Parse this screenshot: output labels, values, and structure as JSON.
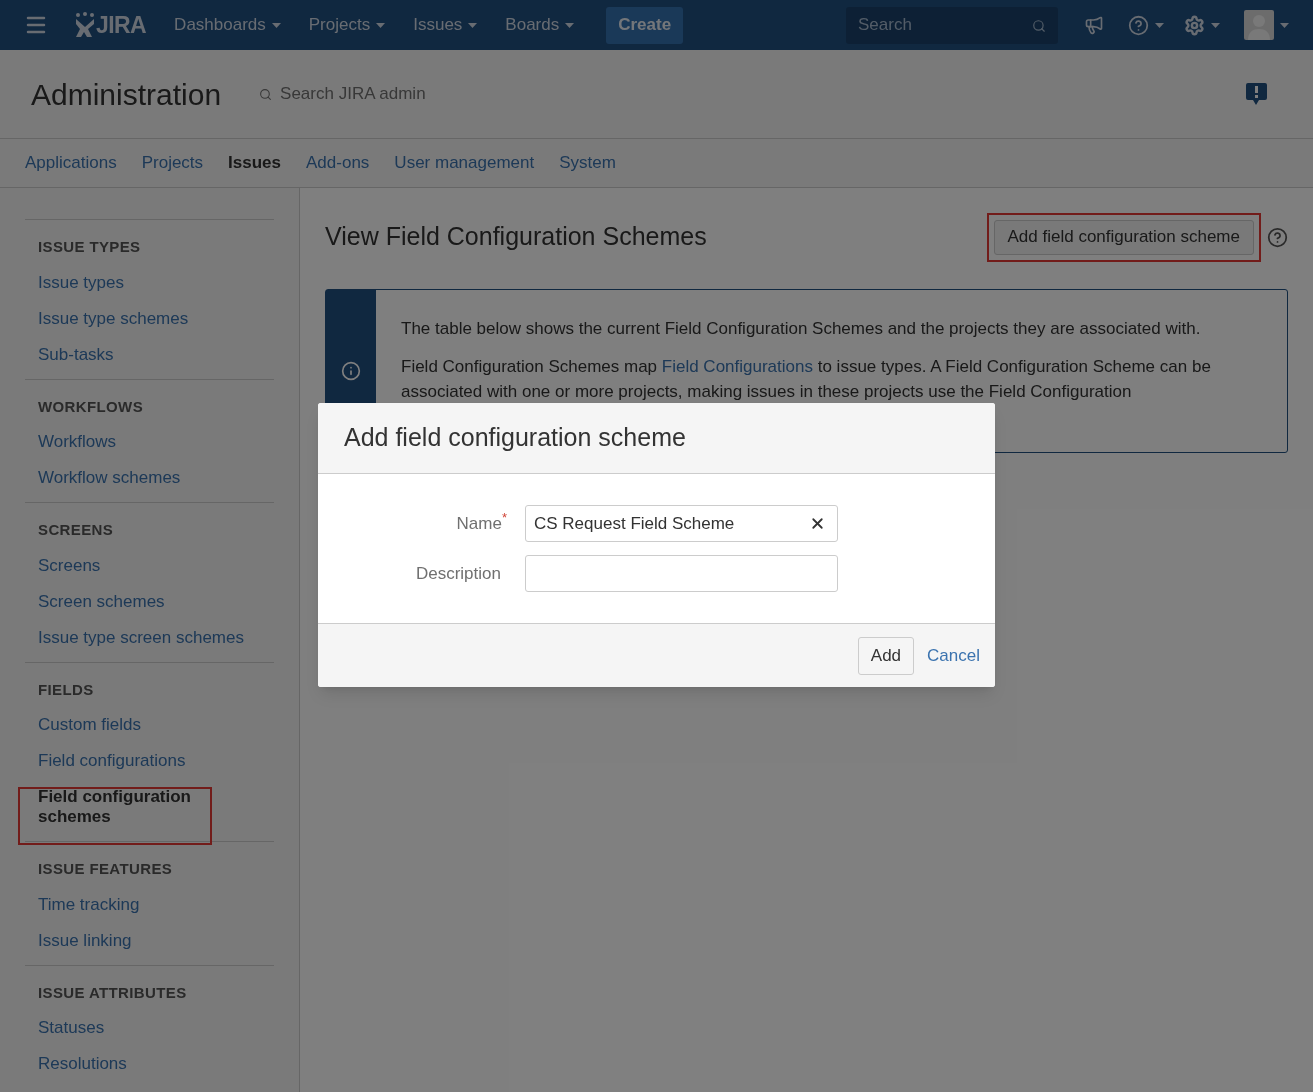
{
  "top_nav": {
    "logo": "JIRA",
    "menus": [
      {
        "label": "Dashboards"
      },
      {
        "label": "Projects"
      },
      {
        "label": "Issues"
      },
      {
        "label": "Boards"
      }
    ],
    "create": "Create",
    "search": {
      "placeholder": "Search"
    }
  },
  "admin": {
    "title": "Administration",
    "search": "Search JIRA admin"
  },
  "tabs": [
    {
      "label": "Applications",
      "selected": false
    },
    {
      "label": "Projects",
      "selected": false
    },
    {
      "label": "Issues",
      "selected": true
    },
    {
      "label": "Add-ons",
      "selected": false
    },
    {
      "label": "User management",
      "selected": false
    },
    {
      "label": "System",
      "selected": false
    }
  ],
  "sidebar": [
    {
      "heading": "ISSUE TYPES",
      "items": [
        {
          "label": "Issue types",
          "selected": false
        },
        {
          "label": "Issue type schemes",
          "selected": false
        },
        {
          "label": "Sub-tasks",
          "selected": false
        }
      ]
    },
    {
      "heading": "WORKFLOWS",
      "items": [
        {
          "label": "Workflows",
          "selected": false
        },
        {
          "label": "Workflow schemes",
          "selected": false
        }
      ]
    },
    {
      "heading": "SCREENS",
      "items": [
        {
          "label": "Screens",
          "selected": false
        },
        {
          "label": "Screen schemes",
          "selected": false
        },
        {
          "label": "Issue type screen schemes",
          "selected": false
        }
      ]
    },
    {
      "heading": "FIELDS",
      "items": [
        {
          "label": "Custom fields",
          "selected": false
        },
        {
          "label": "Field configurations",
          "selected": false
        },
        {
          "label": "Field configuration schemes",
          "selected": true
        }
      ]
    },
    {
      "heading": "ISSUE FEATURES",
      "items": [
        {
          "label": "Time tracking",
          "selected": false
        },
        {
          "label": "Issue linking",
          "selected": false
        }
      ]
    },
    {
      "heading": "ISSUE ATTRIBUTES",
      "items": [
        {
          "label": "Statuses",
          "selected": false
        },
        {
          "label": "Resolutions",
          "selected": false
        }
      ]
    }
  ],
  "page": {
    "title": "View Field Configuration Schemes",
    "action": "Add field configuration scheme",
    "info": {
      "line1": "The table below shows the current Field Configuration Schemes and the projects they are associated with.",
      "before": "Field Configuration Schemes map ",
      "link": "Field Configurations",
      "after": " to issue types. A Field Configuration Scheme can be associated with one or more projects, making issues in these projects use the Field Configuration"
    }
  },
  "dialog": {
    "title": "Add field configuration scheme",
    "fields": [
      {
        "label": "Name",
        "required_mark": "*",
        "value": "CS Request Field Scheme"
      },
      {
        "label": "Description"
      }
    ],
    "submit": "Add",
    "cancel": "Cancel"
  }
}
